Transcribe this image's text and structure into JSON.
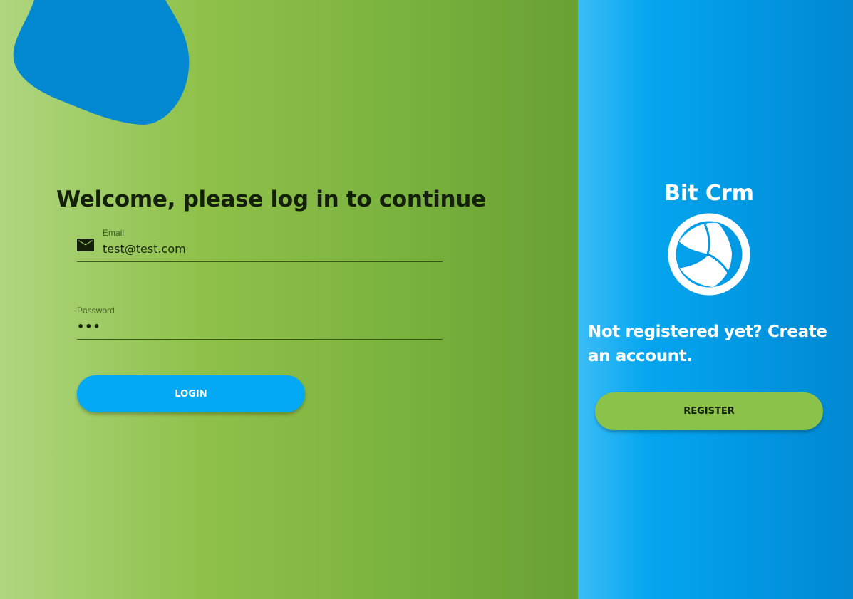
{
  "login": {
    "title": "Welcome, please log in to continue",
    "email": {
      "label": "Email",
      "value": "test@test.com",
      "icon": "mail-icon"
    },
    "password": {
      "label": "Password",
      "value": "•••"
    },
    "login_button": "LOGIN"
  },
  "register": {
    "brand_name": "Bit Crm",
    "brand_icon": "bit-crm-logo-icon",
    "prompt": "Not registered yet? Create an account.",
    "register_button": "REGISTER"
  },
  "colors": {
    "left_gradient": [
      "#afd67f",
      "#8fc14a",
      "#69a033"
    ],
    "right_gradient": [
      "#3cbdf7",
      "#05a6ef",
      "#0288d1"
    ],
    "login_button": "#03a9f4",
    "register_button": "#8bc34a",
    "blob": "#0288d1"
  }
}
